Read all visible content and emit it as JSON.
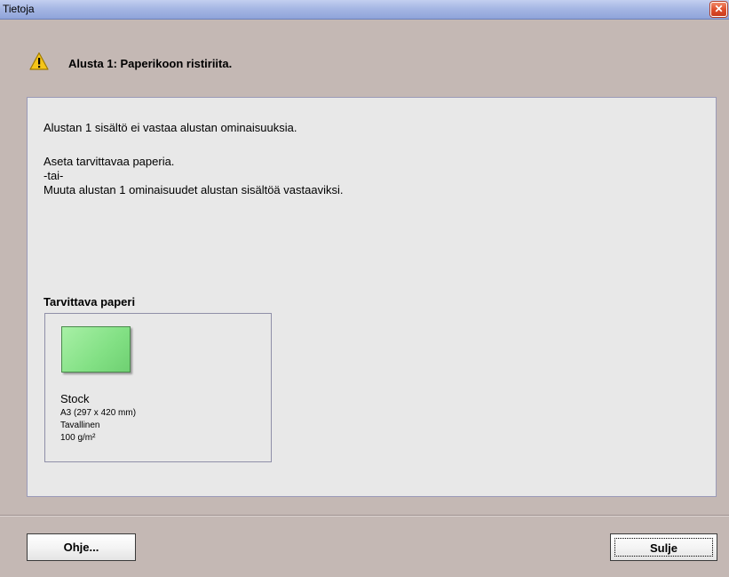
{
  "window": {
    "title": "Tietoja",
    "close_glyph": "✕"
  },
  "header": {
    "icon": "warning-icon",
    "title": "Alusta 1: Paperikoon ristiriita."
  },
  "message": {
    "line1": "Alustan 1 sisältö ei vastaa alustan ominaisuuksia.",
    "line2": "Aseta tarvittavaa paperia.",
    "line3": "-tai-",
    "line4": "Muuta alustan 1 ominaisuudet alustan sisältöä vastaaviksi."
  },
  "required_paper": {
    "label": "Tarvittava paperi",
    "swatch_color": "#8fe38f",
    "name": "Stock",
    "size": "A3 (297 x 420 mm)",
    "type": "Tavallinen",
    "weight": "100 g/m²"
  },
  "buttons": {
    "help_label": "Ohje...",
    "close_label": "Sulje"
  }
}
